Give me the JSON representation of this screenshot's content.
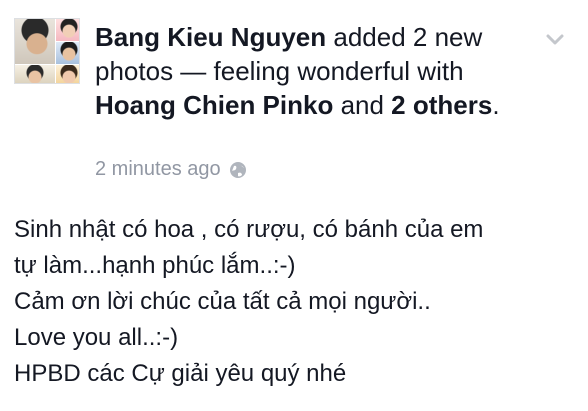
{
  "post": {
    "author": "Bang Kieu Nguyen",
    "action": " added 2 new photos — feeling wonderful with ",
    "tagged_person": "Hoang Chien Pinko",
    "and_text": " and ",
    "others": "2 others",
    "period": ".",
    "timestamp": "2 minutes ago",
    "privacy_icon": "globe-icon",
    "menu_icon": "chevron-down-icon",
    "message_lines": [
      "Sinh nhật có hoa , có rượu, có bánh của em",
      "tự làm...hạnh phúc lắm..:-)",
      "Cảm ơn lời chúc của tất cả mọi người..",
      "Love you all..:-)",
      "HPBD các Cự giải yêu quý nhé"
    ]
  },
  "colors": {
    "text": "#141823",
    "meta": "#9197a3",
    "icon": "#c4c7cc",
    "background": "#ffffff"
  }
}
